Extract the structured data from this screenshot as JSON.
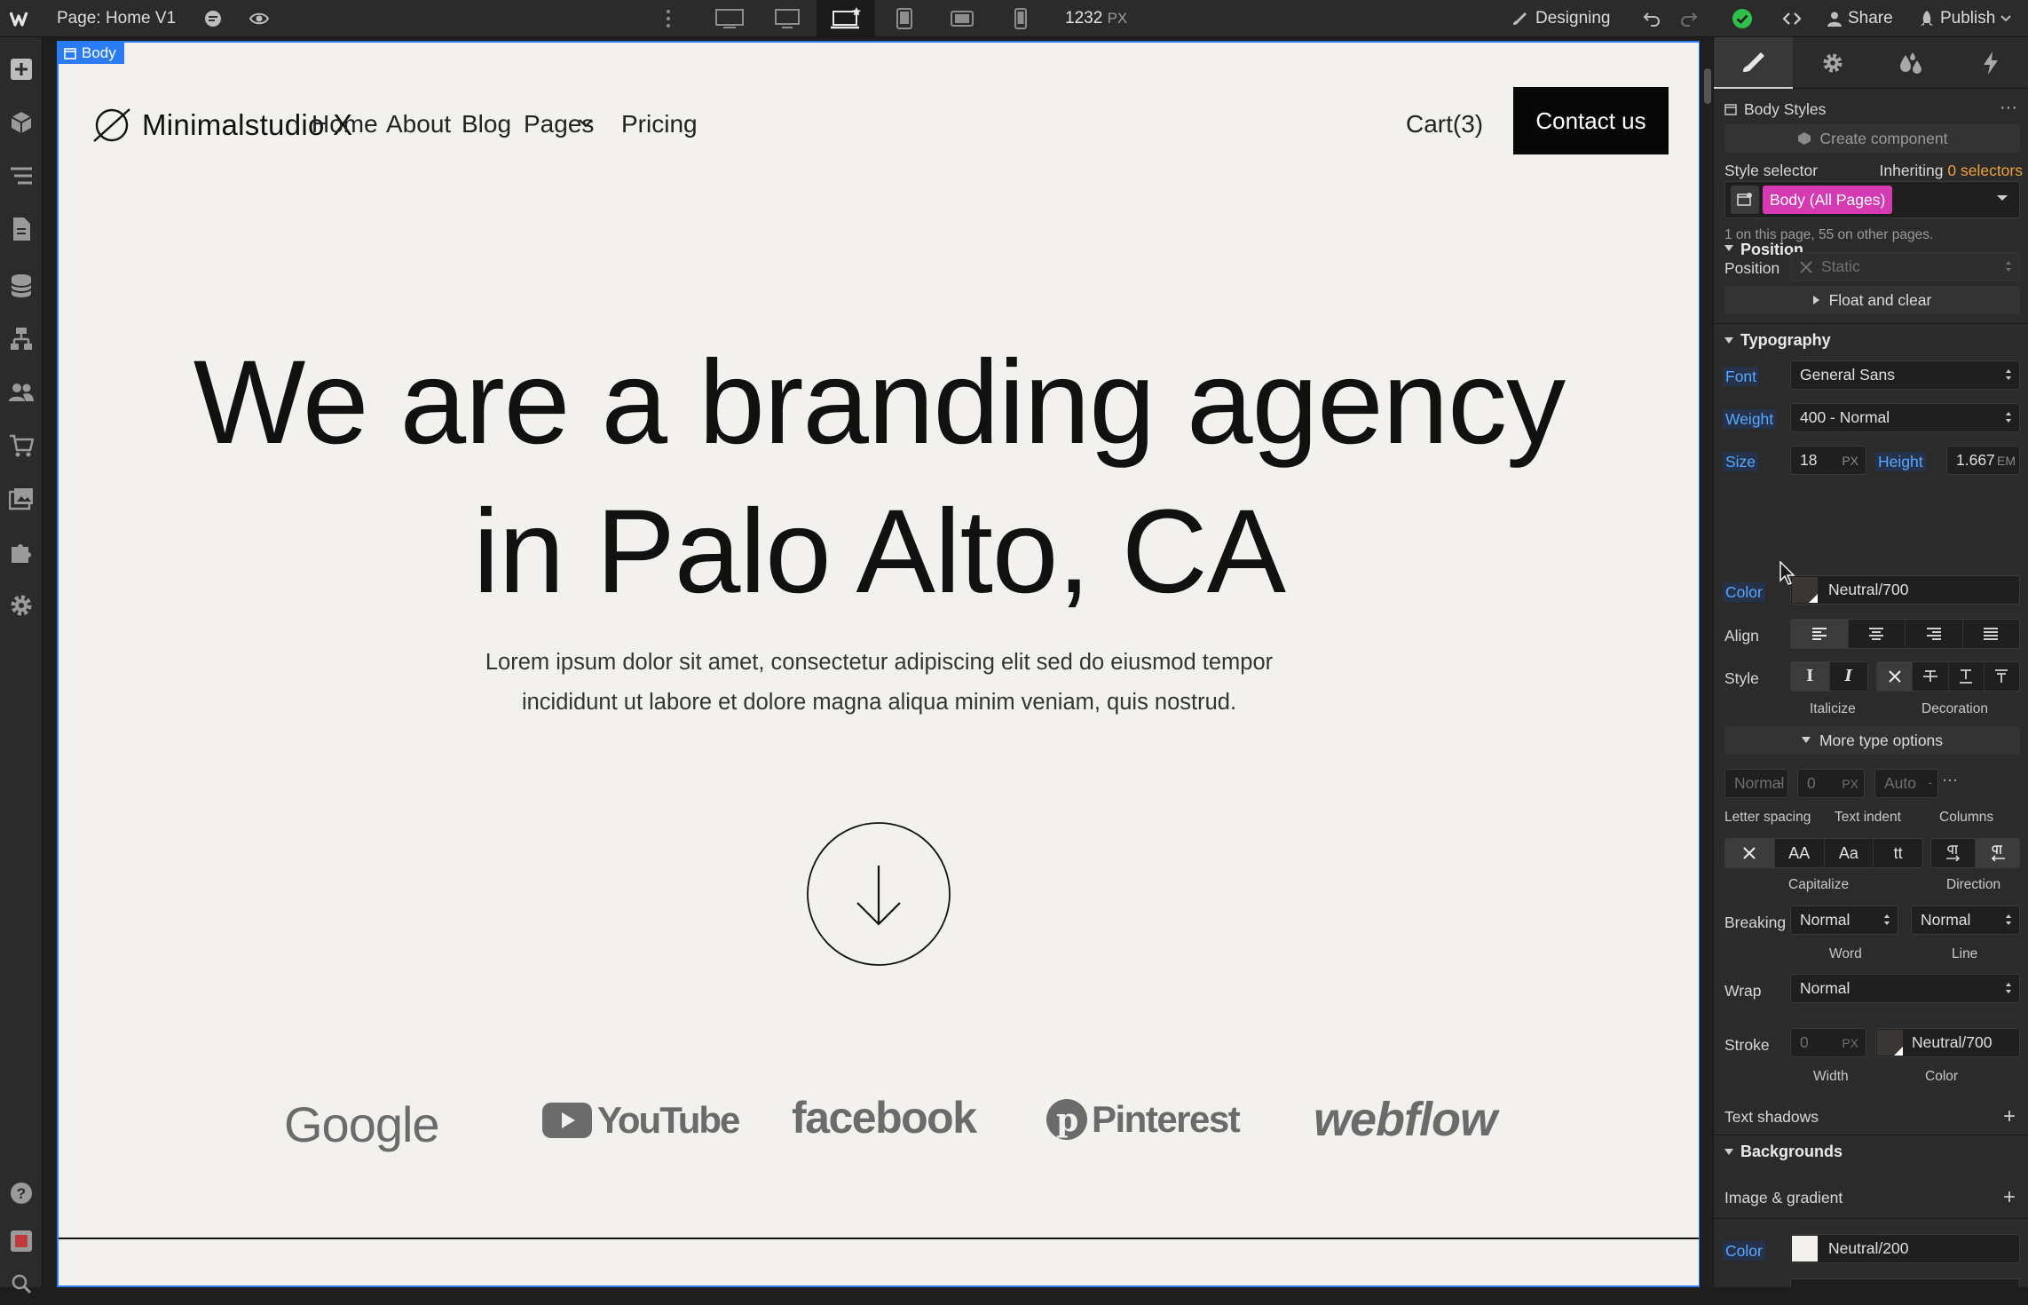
{
  "topbar": {
    "page_label": "Page:",
    "page_name": "Home V1",
    "width_value": "1232",
    "width_unit": "PX",
    "mode": "Designing",
    "share": "Share",
    "publish": "Publish",
    "status_color": "#2fbf4a"
  },
  "canvas": {
    "selected_tag": "Body",
    "site": {
      "logo": "Minimalstudio X",
      "nav": [
        "Home",
        "About",
        "Blog",
        "Pages",
        "Pricing"
      ],
      "cart": "Cart(3)",
      "contact": "Contact us",
      "hero_line1": "We are a branding agency",
      "hero_line2": "in Palo Alto, CA",
      "sub_line1": "Lorem ipsum dolor sit amet, consectetur adipiscing elit sed do eiusmod tempor",
      "sub_line2": "incididunt ut labore et dolore magna aliqua minim veniam, quis nostrud.",
      "brands": [
        "Google",
        "YouTube",
        "facebook",
        "Pinterest",
        "webflow"
      ]
    }
  },
  "panel": {
    "header": "Body Styles",
    "create_component": "Create component",
    "style_selector": "Style selector",
    "inheriting": "Inheriting",
    "inheriting_count": "0 selectors",
    "selector_chip": "Body (All Pages)",
    "selector_chip_color": "#d63ab2",
    "usage": "1 on this page, 55 on other pages.",
    "position_section": "Position",
    "position_label": "Position",
    "position_value": "Static",
    "float_clear": "Float and clear",
    "typography_section": "Typography",
    "font_label": "Font",
    "font_value": "General Sans",
    "weight_label": "Weight",
    "weight_value": "400 - Normal",
    "size_label": "Size",
    "size_value": "18",
    "size_unit": "PX",
    "height_label": "Height",
    "height_value": "1.667",
    "height_unit": "EM",
    "color_label": "Color",
    "color_value": "Neutral/700",
    "color_hex": "#3a3633",
    "align_label": "Align",
    "style_label": "Style",
    "italicize": "Italicize",
    "decoration": "Decoration",
    "more_type": "More type options",
    "letter_spacing_ph": "Normal",
    "text_indent_ph": "0",
    "text_indent_unit": "PX",
    "columns_ph": "Auto",
    "letter_spacing": "Letter spacing",
    "text_indent": "Text indent",
    "columns": "Columns",
    "capitalize": "Capitalize",
    "direction": "Direction",
    "breaking_label": "Breaking",
    "word_break": "Normal",
    "line_break": "Normal",
    "word": "Word",
    "line": "Line",
    "wrap_label": "Wrap",
    "wrap_value": "Normal",
    "stroke_label": "Stroke",
    "stroke_width_ph": "0",
    "stroke_unit": "PX",
    "stroke_color": "Neutral/700",
    "width_caption": "Width",
    "color_caption": "Color",
    "text_shadows": "Text shadows",
    "backgrounds_section": "Backgrounds",
    "image_gradient": "Image & gradient",
    "bg_color_label": "Color",
    "bg_color_value": "Neutral/200",
    "bg_color_hex": "#f3f1ee"
  }
}
